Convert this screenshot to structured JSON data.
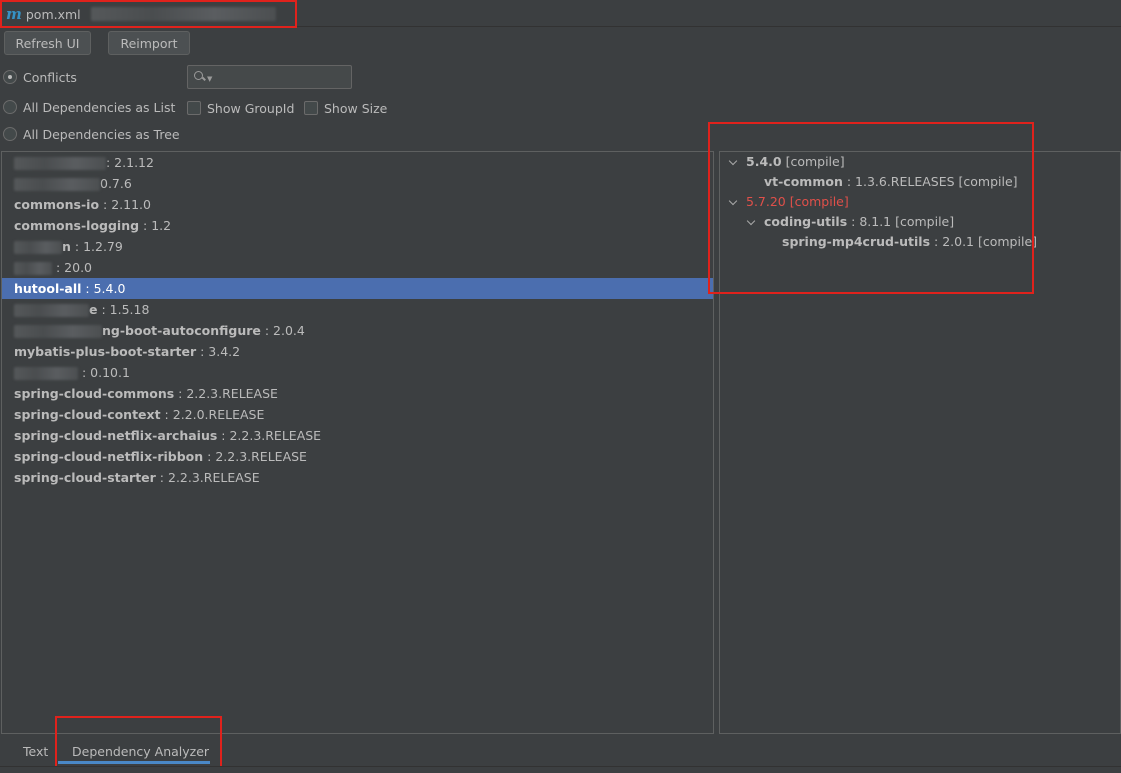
{
  "title_bar": {
    "file_icon": "maven-m-icon",
    "file_name": "pom.xml"
  },
  "toolbar": {
    "refresh_label": "Refresh UI",
    "reimport_label": "Reimport"
  },
  "view_modes": {
    "conflicts_label": "Conflicts",
    "list_label": "All Dependencies as List",
    "tree_label": "All Dependencies as Tree",
    "selected": "Conflicts"
  },
  "options": {
    "show_groupid_label": "Show GroupId",
    "show_size_label": "Show Size"
  },
  "search": {
    "value": ""
  },
  "dependencies": [
    {
      "name": "",
      "version": ": 2.1.12",
      "redacted": true
    },
    {
      "name": "",
      "version": "0.7.6",
      "redacted": true
    },
    {
      "name": "commons-io",
      "version": " : 2.11.0"
    },
    {
      "name": "commons-logging",
      "version": " : 1.2"
    },
    {
      "name": "n",
      "version": " : 1.2.79",
      "redacted": true
    },
    {
      "name": "",
      "version": " : 20.0",
      "redacted": true
    },
    {
      "name": "hutool-all",
      "version": " : 5.4.0",
      "selected": true
    },
    {
      "name": "e",
      "version": " : 1.5.18",
      "redacted": true
    },
    {
      "name": "ng-boot-autoconfigure",
      "version": " : 2.0.4",
      "redacted": true
    },
    {
      "name": "mybatis-plus-boot-starter",
      "version": " : 3.4.2"
    },
    {
      "name": "",
      "version": " : 0.10.1",
      "redacted": true
    },
    {
      "name": "spring-cloud-commons",
      "version": " : 2.2.3.RELEASE"
    },
    {
      "name": "spring-cloud-context",
      "version": " : 2.2.0.RELEASE"
    },
    {
      "name": "spring-cloud-netflix-archaius",
      "version": " : 2.2.3.RELEASE"
    },
    {
      "name": "spring-cloud-netflix-ribbon",
      "version": " : 2.2.3.RELEASE"
    },
    {
      "name": "spring-cloud-starter",
      "version": " : 2.2.3.RELEASE"
    }
  ],
  "usage_tree": [
    {
      "name": "5.4.0",
      "suffix": " [compile]",
      "level": 0,
      "expanded": true,
      "conflict": false
    },
    {
      "name": "vt-common",
      "suffix": " : 1.3.6.RELEASES [compile]",
      "level": 1,
      "expanded": null,
      "conflict": false
    },
    {
      "name": "5.7.20 [compile]",
      "suffix": "",
      "level": 0,
      "expanded": true,
      "conflict": true
    },
    {
      "name": "coding-utils",
      "suffix": " : 8.1.1 [compile]",
      "level": 1,
      "expanded": true,
      "conflict": false
    },
    {
      "name": "spring-mp4crud-utils",
      "suffix": " : 2.0.1 [compile]",
      "level": 2,
      "expanded": null,
      "conflict": false
    }
  ],
  "bottom_tabs": {
    "text_label": "Text",
    "analyzer_label": "Dependency Analyzer",
    "active": "Dependency Analyzer"
  },
  "colors": {
    "background": "#3c3f41",
    "selection": "#4b6eaf",
    "conflict": "#e0504a",
    "highlight_box": "#e0221c",
    "tab_underline": "#4a88c7"
  }
}
